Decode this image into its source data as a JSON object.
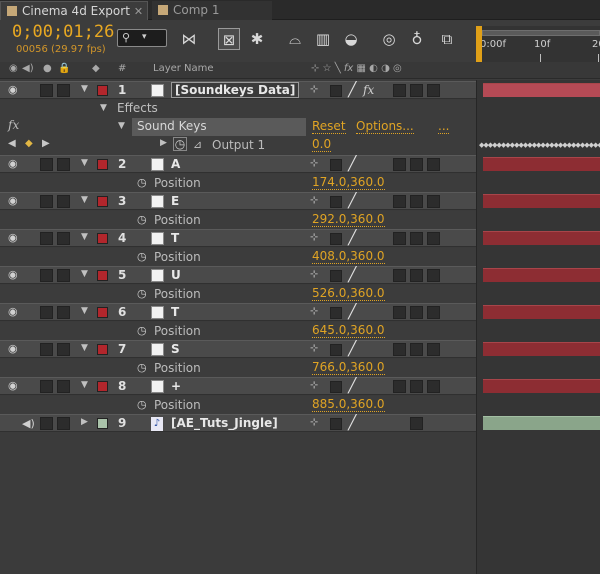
{
  "tabs": [
    {
      "label": "Cinema 4d Export",
      "active": true
    },
    {
      "label": "Comp 1",
      "active": false
    }
  ],
  "header": {
    "timecode": "0;00;01;26",
    "frames": "00056 (29.97 fps)",
    "search_placeholder": ""
  },
  "ruler": {
    "labels": [
      "0:00f",
      "10f",
      "20"
    ],
    "playhead_frame": 0
  },
  "columns": {
    "layer_name": "Layer Name",
    "number": "#"
  },
  "layers": [
    {
      "num": "1",
      "name": "[Soundkeys Data]",
      "label_color": "#b2262c",
      "has_source_box": true,
      "fx": true,
      "selected": true
    },
    {
      "num": "2",
      "name": "A",
      "label_color": "#b2262c",
      "has_source_box": true,
      "prop": "Position",
      "value": "174.0,360.0"
    },
    {
      "num": "3",
      "name": "E",
      "label_color": "#b2262c",
      "has_source_box": true,
      "prop": "Position",
      "value": "292.0,360.0"
    },
    {
      "num": "4",
      "name": "T",
      "label_color": "#b2262c",
      "has_source_box": true,
      "prop": "Position",
      "value": "408.0,360.0"
    },
    {
      "num": "5",
      "name": "U",
      "label_color": "#b2262c",
      "has_source_box": true,
      "prop": "Position",
      "value": "526.0,360.0"
    },
    {
      "num": "6",
      "name": "T",
      "label_color": "#b2262c",
      "has_source_box": true,
      "prop": "Position",
      "value": "645.0,360.0"
    },
    {
      "num": "7",
      "name": "S",
      "label_color": "#b2262c",
      "has_source_box": true,
      "prop": "Position",
      "value": "766.0,360.0"
    },
    {
      "num": "8",
      "name": "+",
      "label_color": "#b2262c",
      "has_source_box": true,
      "prop": "Position",
      "value": "885.0,360.0"
    },
    {
      "num": "9",
      "name": "[AE_Tuts_Jingle]",
      "label_color": "#a9c2a9",
      "audio": true
    }
  ],
  "effects": {
    "group_label": "Effects",
    "effect_name": "Sound Keys",
    "reset_label": "Reset",
    "options_label": "Options...",
    "more_label": "...",
    "output_label": "Output 1",
    "output_value": "0.0"
  },
  "colors": {
    "accent": "#e0a424",
    "bar": "#8d2d33",
    "audio_bar": "#8aa58a"
  }
}
